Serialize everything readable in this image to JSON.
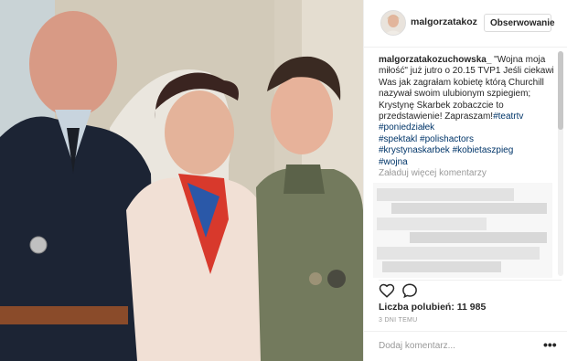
{
  "post": {
    "username": "malgorzatakoz",
    "follow_label": "Obserwowanie"
  },
  "caption": {
    "user": "malgorzatakozuchowska_",
    "text_before_tags": " \"Wojna moja miłość\" już jutro o 20.15 TVP1 Jeśli ciekawi Was jak zagrałam kobietę którą Churchill nazywał swoim ulubionym szpiegiem; Krystynę Skarbek zobaczcie to przedstawienie! Zapraszam!",
    "tags": [
      "#teatrtv",
      "#poniedziałek",
      "#spektakl",
      "#polishactors",
      "#krystynaskarbek",
      "#kobietaszpieg",
      "#wojna"
    ]
  },
  "comments": {
    "load_more": "Załaduj więcej komentarzy"
  },
  "stats": {
    "likes": "Liczba polubień: 11 985",
    "time": "3 DNI TEMU"
  },
  "add_comment": {
    "placeholder": "Dodaj komentarz...",
    "more": "•••"
  },
  "icons": {
    "like": "heart-icon",
    "comment": "comment-bubble-icon",
    "more": "ellipsis-icon"
  },
  "colors": {
    "hashtag": "#003569",
    "muted": "#999999",
    "border": "#efefef"
  }
}
